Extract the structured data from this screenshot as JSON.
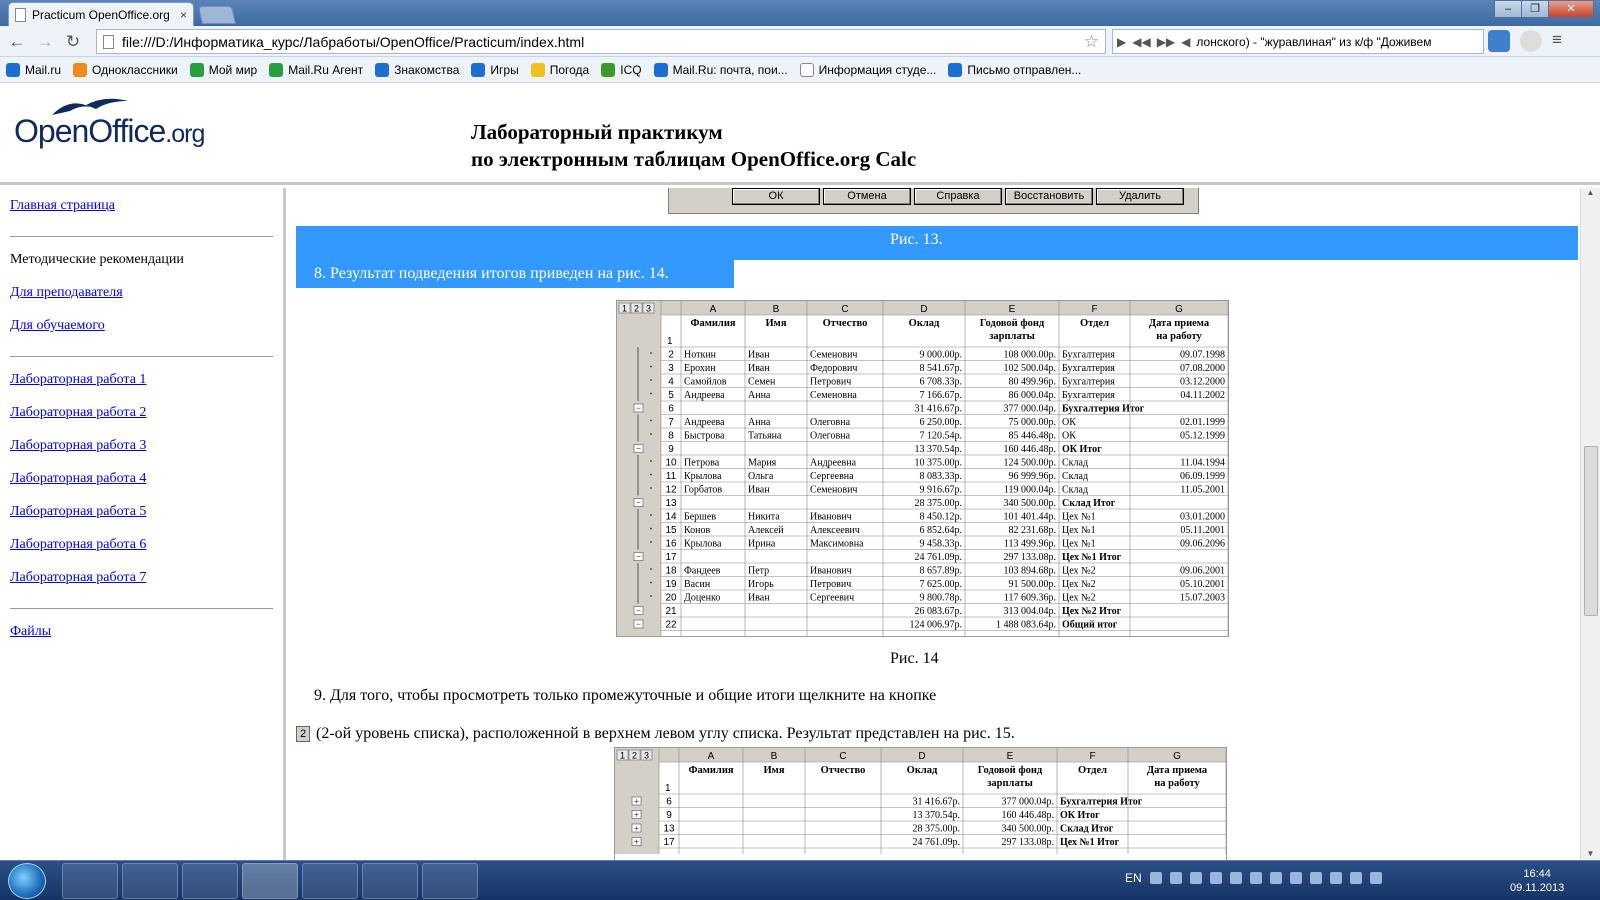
{
  "browser": {
    "tab_title": "Practicum OpenOffice.org",
    "tab_close": "×",
    "url": "file:///D:/Информатика_курс/Лабработы/OpenOffice/Practicum/index.html",
    "media_text": "лонского) - \"журавлиная\" из к/ф \"Доживем",
    "bookmarks": [
      "Mail.ru",
      "Одноклассники",
      "Мой мир",
      "Mail.Ru Агент",
      "Знакомства",
      "Игры",
      "Погода",
      "ICQ",
      "Mail.Ru: почта, пои...",
      "Информация студе...",
      "Письмо отправлен..."
    ]
  },
  "header": {
    "logo_main": "OpenOffice",
    "logo_suffix": ".org",
    "title_line1": "Лабораторный практикум",
    "title_line2": "по электронным таблицам OpenOffice.org Calc"
  },
  "sidebar": {
    "home": "Главная страница",
    "method": "Методические рекомендации",
    "teacher": "Для преподавателя",
    "student": "Для обучаемого",
    "labs": [
      "Лабораторная работа 1",
      "Лабораторная работа 2",
      "Лабораторная работа 3",
      "Лабораторная работа 4",
      "Лабораторная работа 5",
      "Лабораторная работа 6",
      "Лабораторная работа 7"
    ],
    "files": "Файлы"
  },
  "content": {
    "dialog_buttons": [
      "ОК",
      "Отмена",
      "Справка",
      "Восстановить",
      "Удалить"
    ],
    "caption13": "Рис. 13.",
    "item8": "8.  Результат подведения итогов приведен на рис. 14.",
    "caption14": "Рис. 14",
    "item9": "9.  Для того, чтобы просмотреть только промежуточные и общие итоги щелкните на кнопке",
    "level_button": "2",
    "item9_cont": "(2-ой уровень списка), расположенной в верхнем левом углу списка. Результат представлен на рис. 15."
  },
  "sheet14": {
    "levels": [
      "1",
      "2",
      "3"
    ],
    "cols": [
      "A",
      "B",
      "C",
      "D",
      "E",
      "F",
      "G"
    ],
    "headers": [
      "Фамилия",
      "Имя",
      "Отчество",
      "Оклад",
      "Годовой фонд зарплаты",
      "Отдел",
      "Дата приема на работу"
    ],
    "rows": [
      [
        "2",
        "Ноткин",
        "Иван",
        "Семенович",
        "9 000.00р.",
        "108 000.00р.",
        "Бухгалтерия",
        "09.07.1998"
      ],
      [
        "3",
        "Ерохин",
        "Иван",
        "Федорович",
        "8 541.67р.",
        "102 500.04р.",
        "Бухгалтерия",
        "07.08.2000"
      ],
      [
        "4",
        "Самойлов",
        "Семен",
        "Петрович",
        "6 708.33р.",
        "80 499.96р.",
        "Бухгалтерия",
        "03.12.2000"
      ],
      [
        "5",
        "Андреева",
        "Анна",
        "Семеновна",
        "7 166.67р.",
        "86 000.04р.",
        "Бухгалтерия",
        "04.11.2002"
      ],
      [
        "6",
        "",
        "",
        "",
        "31 416.67р.",
        "377 000.04р.",
        "Бухгалтерия Итог",
        ""
      ],
      [
        "7",
        "Андреева",
        "Анна",
        "Олеговна",
        "6 250.00р.",
        "75 000.00р.",
        "ОК",
        "02.01.1999"
      ],
      [
        "8",
        "Быстрова",
        "Татьяна",
        "Олеговна",
        "7 120.54р.",
        "85 446.48р.",
        "ОК",
        "05.12.1999"
      ],
      [
        "9",
        "",
        "",
        "",
        "13 370.54р.",
        "160 446.48р.",
        "ОК Итог",
        ""
      ],
      [
        "10",
        "Петрова",
        "Мария",
        "Андреевна",
        "10 375.00р.",
        "124 500.00р.",
        "Склад",
        "11.04.1994"
      ],
      [
        "11",
        "Крылова",
        "Ольга",
        "Сергеевна",
        "8 083.33р.",
        "96 999.96р.",
        "Склад",
        "06.09.1999"
      ],
      [
        "12",
        "Горбатов",
        "Иван",
        "Семенович",
        "9 916.67р.",
        "119 000.04р.",
        "Склад",
        "11.05.2001"
      ],
      [
        "13",
        "",
        "",
        "",
        "28 375.00р.",
        "340 500.00р.",
        "Склад Итог",
        ""
      ],
      [
        "14",
        "Бершев",
        "Никита",
        "Иванович",
        "8 450.12р.",
        "101 401.44р.",
        "Цех №1",
        "03.01.2000"
      ],
      [
        "15",
        "Конов",
        "Алексей",
        "Алексеевич",
        "6 852.64р.",
        "82 231.68р.",
        "Цех №1",
        "05.11.2001"
      ],
      [
        "16",
        "Крылова",
        "Ирина",
        "Максимовна",
        "9 458.33р.",
        "113 499.96р.",
        "Цех №1",
        "09.06.2096"
      ],
      [
        "17",
        "",
        "",
        "",
        "24 761.09р.",
        "297 133.08р.",
        "Цех №1 Итог",
        ""
      ],
      [
        "18",
        "Фандеев",
        "Петр",
        "Иванович",
        "8 657.89р.",
        "103 894.68р.",
        "Цех №2",
        "09.06.2001"
      ],
      [
        "19",
        "Васин",
        "Игорь",
        "Петрович",
        "7 625.00р.",
        "91 500.00р.",
        "Цех №2",
        "05.10.2001"
      ],
      [
        "20",
        "Доценко",
        "Иван",
        "Сергеевич",
        "9 800.78р.",
        "117 609.36р.",
        "Цех №2",
        "15.07.2003"
      ],
      [
        "21",
        "",
        "",
        "",
        "26 083.67р.",
        "313 004.04р.",
        "Цех №2 Итог",
        ""
      ],
      [
        "22",
        "",
        "",
        "",
        "124 006.97р.",
        "1 488 083.64р.",
        "Общий итог",
        ""
      ]
    ]
  },
  "sheet15": {
    "rows": [
      [
        "6",
        "",
        "",
        "",
        "31 416.67р.",
        "377 000.04р.",
        "Бухгалтерия Итог",
        ""
      ],
      [
        "9",
        "",
        "",
        "",
        "13 370.54р.",
        "160 446.48р.",
        "ОК Итог",
        ""
      ],
      [
        "13",
        "",
        "",
        "",
        "28 375.00р.",
        "340 500.00р.",
        "Склад Итог",
        ""
      ],
      [
        "17",
        "",
        "",
        "",
        "24 761.09р.",
        "297 133.08р.",
        "Цех №1 Итог",
        ""
      ]
    ]
  },
  "taskbar": {
    "lang": "EN",
    "time": "16:44",
    "date": "09.11.2013"
  }
}
